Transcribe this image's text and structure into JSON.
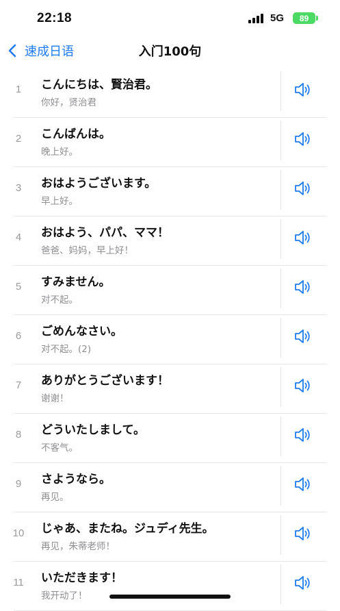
{
  "status": {
    "time": "22:18",
    "network": "5G",
    "battery": "89"
  },
  "nav": {
    "back_label": "速成日语",
    "title": "入门100句"
  },
  "colors": {
    "accent": "#1f7cf0",
    "battery": "#4cd964"
  },
  "icons": {
    "back": "chevron-left-icon",
    "speaker": "speaker-icon"
  },
  "rows": [
    {
      "num": "1",
      "jp": "こんにちは、賢治君。",
      "cn": "你好，贤治君"
    },
    {
      "num": "2",
      "jp": "こんばんは。",
      "cn": "晚上好。"
    },
    {
      "num": "3",
      "jp": "おはようございます。",
      "cn": "早上好。"
    },
    {
      "num": "4",
      "jp": "おはよう、パパ、ママ！",
      "cn": "爸爸、妈妈，早上好！"
    },
    {
      "num": "5",
      "jp": "すみません。",
      "cn": "对不起。"
    },
    {
      "num": "6",
      "jp": "ごめんなさい。",
      "cn": "对不起。(2)"
    },
    {
      "num": "7",
      "jp": "ありがとうございます！",
      "cn": "谢谢！"
    },
    {
      "num": "8",
      "jp": "どういたしまして。",
      "cn": "不客气。"
    },
    {
      "num": "9",
      "jp": "さようなら。",
      "cn": "再见。"
    },
    {
      "num": "10",
      "jp": "じゃあ、またね。ジュディ先生。",
      "cn": "再见，朱蒂老师！"
    },
    {
      "num": "11",
      "jp": "いただきます！",
      "cn": "我开动了！"
    }
  ]
}
